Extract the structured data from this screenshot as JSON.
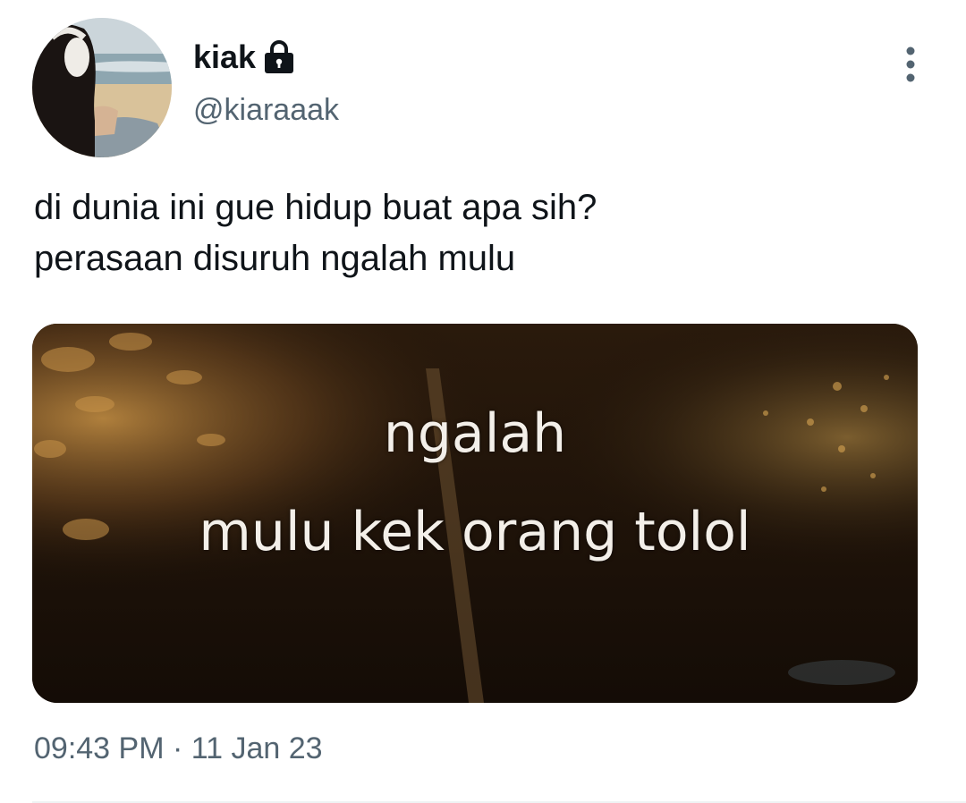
{
  "author": {
    "display_name": "kiak",
    "handle": "@kiaraaak",
    "protected_icon": "lock-icon",
    "avatar_icon": "profile-photo"
  },
  "actions": {
    "more_icon": "more-vertical-icon"
  },
  "tweet": {
    "text_lines": [
      "di dunia ini gue hidup buat apa sih?",
      "perasaan disuruh ngalah mulu"
    ],
    "media": {
      "caption_lines": [
        "ngalah",
        "mulu kek orang tolol"
      ]
    },
    "time": "09:43 PM",
    "separator": "·",
    "date": "11 Jan 23"
  },
  "colors": {
    "text": "#0f1419",
    "secondary": "#536471",
    "divider": "#eff3f4",
    "media_bg": "#1d1209"
  }
}
